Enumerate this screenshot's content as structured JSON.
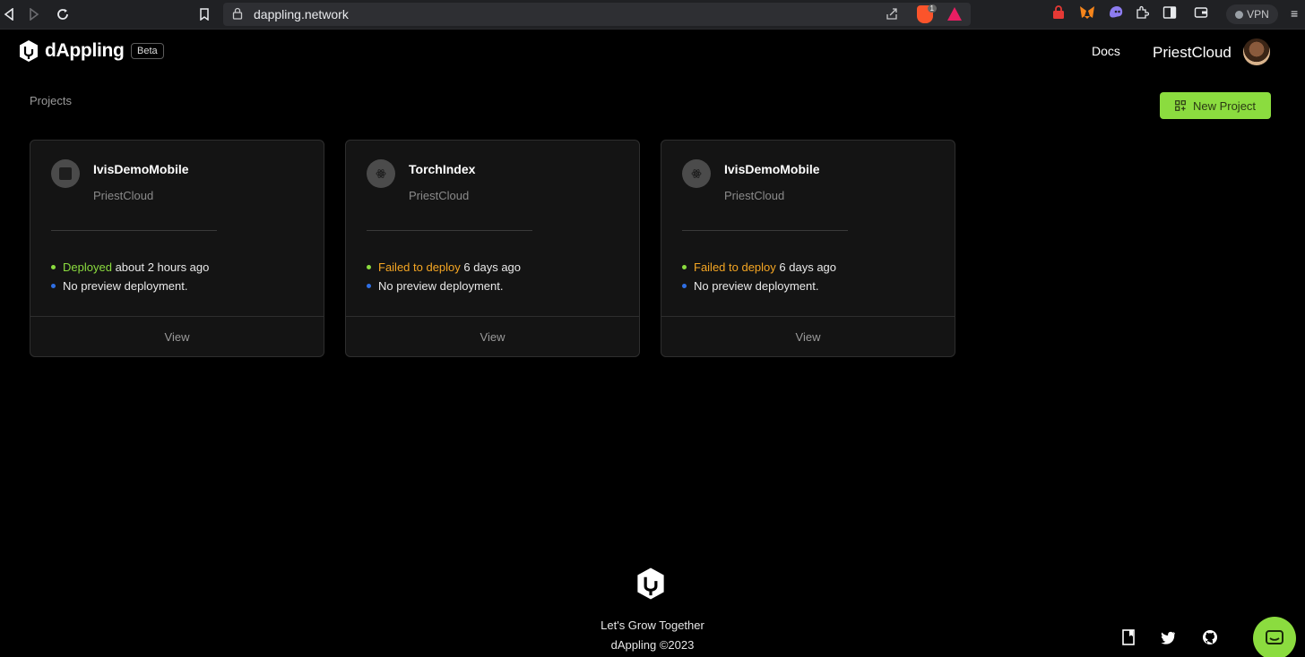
{
  "browser": {
    "url": "dappling.network",
    "brave_badge": "1",
    "vpn_label": "VPN"
  },
  "header": {
    "logo_text": "dAppling",
    "beta_label": "Beta",
    "docs_label": "Docs",
    "username": "PriestCloud"
  },
  "main": {
    "section_label": "Projects",
    "new_project_label": "New Project",
    "view_label": "View",
    "projects": [
      {
        "name": "IvisDemoMobile",
        "owner": "PriestCloud",
        "status_text": "Deployed",
        "status_time": "about 2 hours ago",
        "status_color": "#8bdc3f",
        "preview_text": "No preview deployment.",
        "icon": "square-icon"
      },
      {
        "name": "TorchIndex",
        "owner": "PriestCloud",
        "status_text": "Failed to deploy",
        "status_time": "6 days ago",
        "status_color": "#f5a623",
        "preview_text": "No preview deployment.",
        "icon": "react-icon"
      },
      {
        "name": "IvisDemoMobile",
        "owner": "PriestCloud",
        "status_text": "Failed to deploy",
        "status_time": "6 days ago",
        "status_color": "#f5a623",
        "preview_text": "No preview deployment.",
        "icon": "react-icon"
      }
    ]
  },
  "footer": {
    "tagline": "Let's Grow Together",
    "copyright": "dAppling ©2023"
  },
  "colors": {
    "accent": "#8bdc3f",
    "failed": "#f5a623",
    "preview_bullet": "#2f6fe4"
  }
}
